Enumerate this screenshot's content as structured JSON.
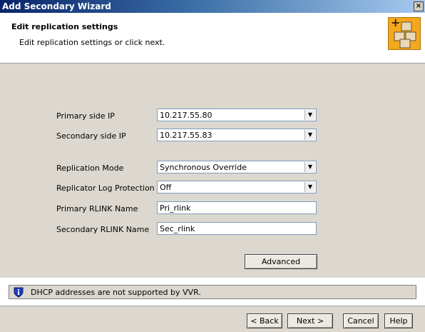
{
  "window": {
    "title": "Add Secondary Wizard",
    "close_glyph": "×"
  },
  "header": {
    "title": "Edit replication settings",
    "subtitle": "Edit replication settings or click next."
  },
  "form": {
    "primary_ip": {
      "label": "Primary side IP",
      "value": "10.217.55.80"
    },
    "secondary_ip": {
      "label": "Secondary side IP",
      "value": "10.217.55.83"
    },
    "replication_mode": {
      "label": "Replication Mode",
      "value": "Synchronous Override"
    },
    "log_protection": {
      "label": "Replicator Log Protection",
      "value": "Off"
    },
    "primary_rlink": {
      "label": "Primary RLINK Name",
      "value": "Pri_rlink"
    },
    "secondary_rlink": {
      "label": "Secondary RLINK Name",
      "value": "Sec_rlink"
    },
    "advanced_label": "Advanced"
  },
  "info": {
    "text": "DHCP addresses are not supported by VVR."
  },
  "footer": {
    "back": "< Back",
    "next": "Next >",
    "cancel": "Cancel",
    "help": "Help"
  },
  "icons": {
    "dropdown": "chevron-down-icon",
    "info": "shield-info-icon",
    "wizard": "boxes-plus-icon"
  }
}
